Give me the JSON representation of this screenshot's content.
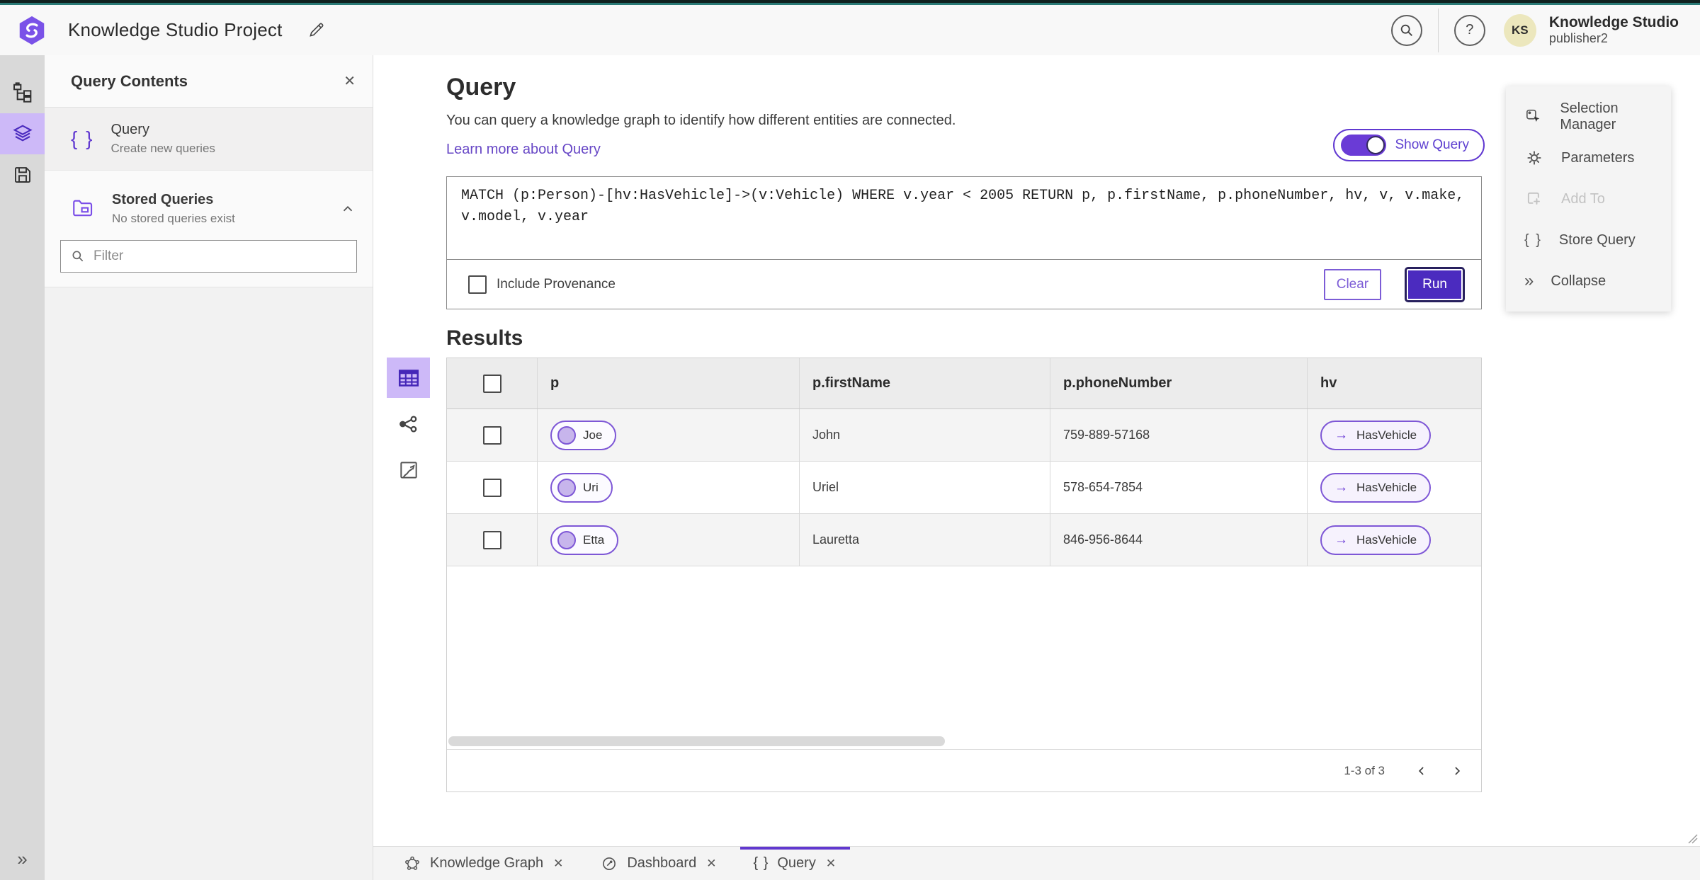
{
  "app": {
    "top_title": "Knowledge Studio Project",
    "user_initials": "KS",
    "user_name": "Knowledge Studio",
    "user_role": "publisher2"
  },
  "icons": {
    "close": "✕",
    "question": "?",
    "braces": "{ }",
    "arrow_right": "→",
    "collapse": "»"
  },
  "query_contents": {
    "title": "Query Contents",
    "query": {
      "title": "Query",
      "subtitle": "Create new queries"
    },
    "stored_queries": {
      "title": "Stored Queries",
      "subtitle": "No stored queries exist"
    },
    "filter_placeholder": "Filter"
  },
  "query_page": {
    "title": "Query",
    "description": "You can query a knowledge graph to identify how different entities are connected.",
    "learn_more_link": "Learn more about Query",
    "show_query_label": "Show Query",
    "query_text": "MATCH (p:Person)-[hv:HasVehicle]->(v:Vehicle) WHERE v.year < 2005 RETURN p, p.firstName, p.phoneNumber, hv, v, v.make, v.model, v.year",
    "include_provenance_label": "Include Provenance",
    "clear_button": "Clear",
    "run_button": "Run"
  },
  "results": {
    "title": "Results",
    "columns": [
      "p",
      "p.firstName",
      "p.phoneNumber",
      "hv"
    ],
    "rows": [
      {
        "p": "Joe",
        "p_firstName": "John",
        "p_phoneNumber": "759-889-57168",
        "hv": "HasVehicle"
      },
      {
        "p": "Uri",
        "p_firstName": "Uriel",
        "p_phoneNumber": "578-654-7854",
        "hv": "HasVehicle"
      },
      {
        "p": "Etta",
        "p_firstName": "Lauretta",
        "p_phoneNumber": "846-956-8644",
        "hv": "HasVehicle"
      }
    ],
    "pagination": "1-3 of 3"
  },
  "actions_panel": {
    "selection_manager": "Selection Manager",
    "parameters": "Parameters",
    "add_to": "Add To",
    "store_query": "Store Query",
    "collapse": "Collapse"
  },
  "tabs": [
    {
      "label": "Knowledge Graph"
    },
    {
      "label": "Dashboard"
    },
    {
      "label": "Query"
    }
  ],
  "colors": {
    "accent_purple": "#6139d1",
    "deep_purple": "#4b2bbf",
    "rail_active_bg": "#cdb9f8",
    "teal_line": "#2a7a76",
    "avatar_bg": "#ece7bd"
  }
}
